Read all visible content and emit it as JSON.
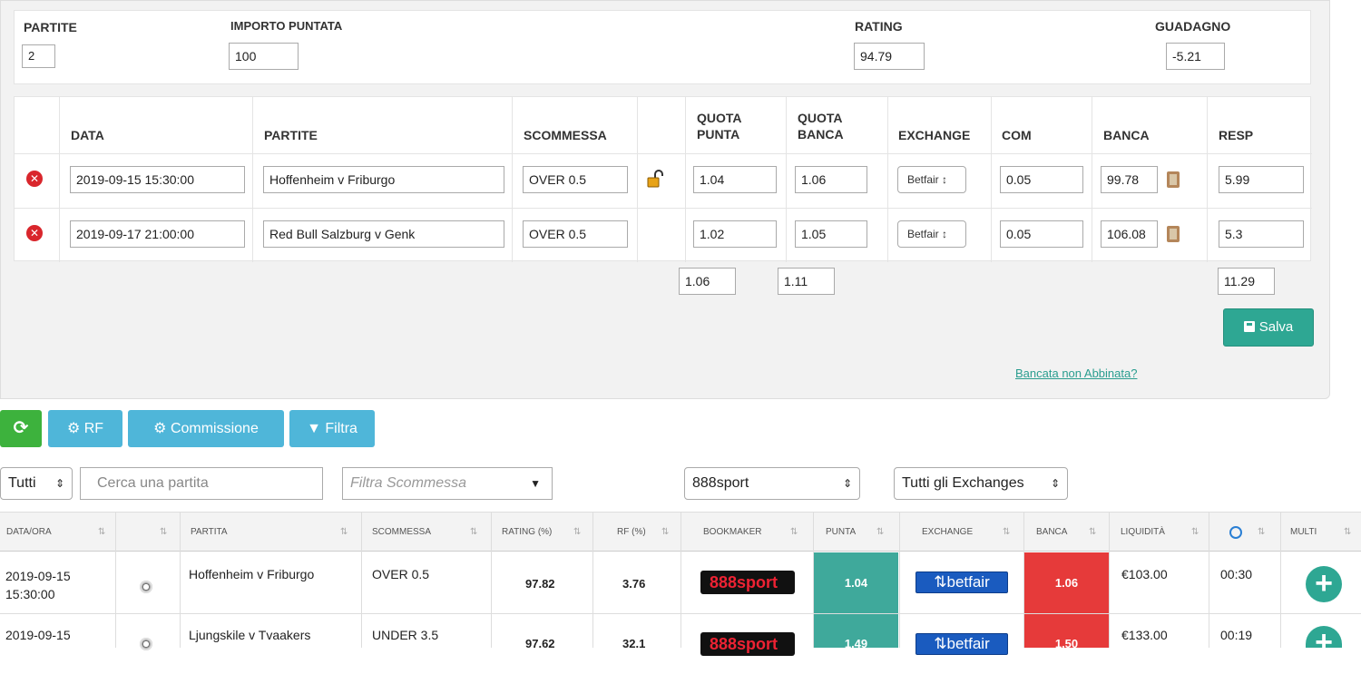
{
  "summary": {
    "partite_label": "PARTITE",
    "partite_value": "2",
    "importo_label": "IMPORTO PUNTATA",
    "importo_value": "100",
    "rating_label": "RATING",
    "rating_value": "94.79",
    "guadagno_label": "GUADAGNO",
    "guadagno_value": "-5.21"
  },
  "bet_table": {
    "headers": {
      "data": "DATA",
      "partite": "PARTITE",
      "scommessa": "SCOMMESSA",
      "quota_punta_1": "QUOTA",
      "quota_punta_2": "PUNTA",
      "quota_banca_1": "QUOTA",
      "quota_banca_2": "BANCA",
      "exchange": "EXCHANGE",
      "com": "COM",
      "banca": "BANCA",
      "resp": "RESP"
    },
    "rows": [
      {
        "data": "2019-09-15 15:30:00",
        "partite": "Hoffenheim v Friburgo",
        "scommessa": "OVER 0.5",
        "quota_punta": "1.04",
        "quota_banca": "1.06",
        "exchange": "Betfair ↕",
        "com": "0.05",
        "banca": "99.78",
        "resp": "5.99"
      },
      {
        "data": "2019-09-17 21:00:00",
        "partite": "Red Bull Salzburg v Genk",
        "scommessa": "OVER 0.5",
        "quota_punta": "1.02",
        "quota_banca": "1.05",
        "exchange": "Betfair ↕",
        "com": "0.05",
        "banca": "106.08",
        "resp": "5.3"
      }
    ],
    "totals": {
      "quota_punta": "1.06",
      "quota_banca": "1.11",
      "resp": "11.29"
    }
  },
  "actions": {
    "salva": "Salva",
    "bancata_link": "Bancata non Abbinata?"
  },
  "toolbar": {
    "refresh_icon": "refresh-icon",
    "rf": "RF",
    "commissione": "Commissione",
    "filtra": "Filtra"
  },
  "filters": {
    "tutti": "Tutti",
    "search_placeholder": "Cerca una partita",
    "filtra_scommessa": "Filtra Scommessa",
    "bookmaker": "888sport",
    "exchanges": "Tutti gli Exchanges"
  },
  "grid": {
    "columns": [
      "DATA/ORA",
      "",
      "PARTITA",
      "SCOMMESSA",
      "RATING (%)",
      "RF (%)",
      "BOOKMAKER",
      "PUNTA",
      "EXCHANGE",
      "BANCA",
      "LIQUIDITÀ",
      "",
      "MULTI"
    ],
    "rows": [
      {
        "date1": "2019-09-15",
        "date2": "15:30:00",
        "partita": "Hoffenheim v Friburgo",
        "scommessa": "OVER 0.5",
        "rating": "97.82",
        "rf": "3.76",
        "bookmaker": "888sport",
        "punta": "1.04",
        "exchange": "betfair",
        "banca": "1.06",
        "liquidita": "€103.00",
        "time": "00:30"
      },
      {
        "date1": "2019-09-15",
        "date2": "",
        "partita": "Ljungskile v Tvaakers",
        "scommessa": "UNDER 3.5",
        "rating": "97.62",
        "rf": "32.1",
        "bookmaker": "888sport",
        "punta": "1.49",
        "exchange": "betfair",
        "banca": "1.50",
        "liquidita": "€133.00",
        "time": "00:19"
      }
    ]
  },
  "colors": {
    "accent": "#2ea793",
    "info": "#4fb6d9",
    "danger": "#e63a3a",
    "success": "#3db23d"
  }
}
